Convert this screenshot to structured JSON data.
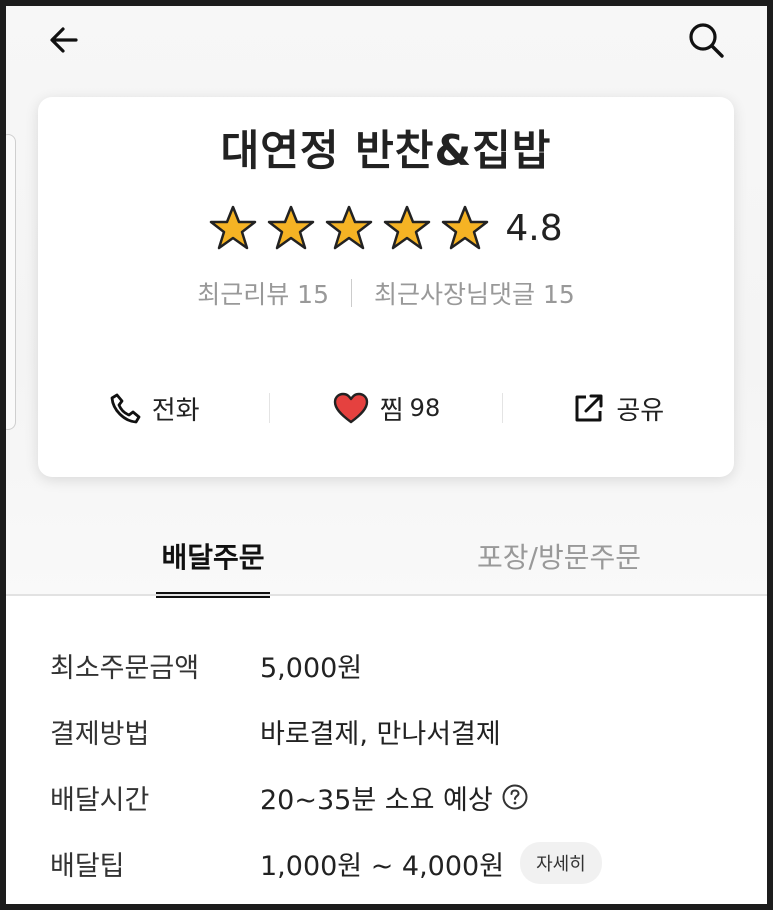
{
  "header": {
    "back_icon": "arrow-left-icon",
    "search_icon": "search-icon"
  },
  "store": {
    "name": "대연정 반찬&집밥",
    "rating": "4.8",
    "stars": 5,
    "recent_reviews_label": "최근리뷰 15",
    "recent_owner_replies_label": "최근사장님댓글 15"
  },
  "actions": {
    "call_label": "전화",
    "like_label": "찜",
    "like_count": "98",
    "share_label": "공유"
  },
  "tabs": [
    {
      "label": "배달주문",
      "active": true
    },
    {
      "label": "포장/방문주문",
      "active": false
    }
  ],
  "info": {
    "min_order_label": "최소주문금액",
    "min_order_value": "5,000원",
    "payment_label": "결제방법",
    "payment_value": "바로결제, 만나서결제",
    "delivery_time_label": "배달시간",
    "delivery_time_value": "20~35분 소요 예상",
    "delivery_tip_label": "배달팁",
    "delivery_tip_value": "1,000원 ~ 4,000원",
    "detail_button": "자세히"
  },
  "colors": {
    "star": "#f5b324",
    "heart": "#e5413f",
    "tab_active": "#111111",
    "muted_text": "#999999"
  }
}
